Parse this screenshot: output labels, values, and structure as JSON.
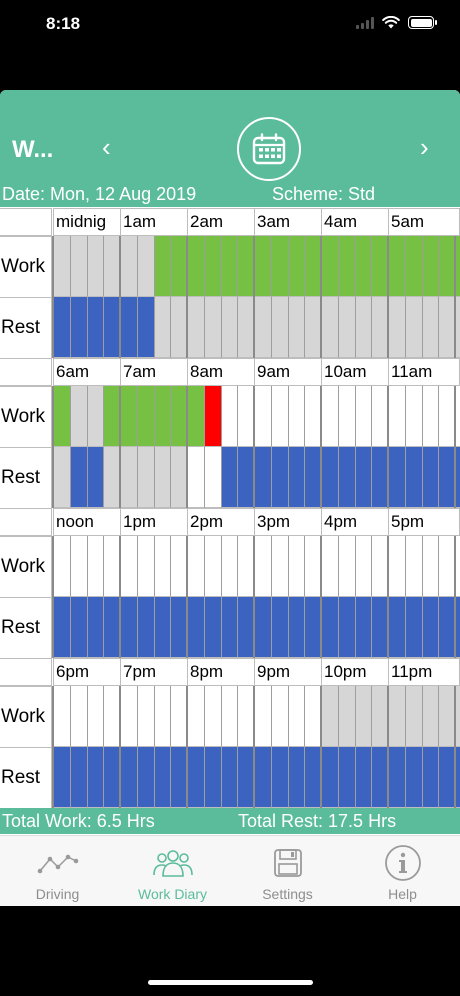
{
  "status": {
    "time": "8:18"
  },
  "header": {
    "title": "W...",
    "prev": "‹",
    "next": "›"
  },
  "info": {
    "date": "Date: Mon, 12 Aug 2019",
    "scheme": "Scheme: Std"
  },
  "row_labels": {
    "work": "Work",
    "rest": "Rest"
  },
  "colors": {
    "work": "#76c043",
    "rest": "#3b63bf",
    "none": "#d6d6d6",
    "empty": "#ffffff",
    "current": "#ff0000",
    "accent": "#5bbc9c"
  },
  "blocks": [
    {
      "hours": [
        "midnig",
        "1am",
        "2am",
        "3am",
        "4am",
        "5am"
      ],
      "work": "NNNNNNGGGGGGGGGGGGGGGGGG",
      "rest": "BBBBBBNNNNNNNNNNNNNNNNNN"
    },
    {
      "hours": [
        "6am",
        "7am",
        "8am",
        "9am",
        "10am",
        "11am"
      ],
      "work": "GNNGGGGGGRWWWWWWWWWWWWWW",
      "rest": "NBBNNNNNWWBBBBBBBBBBBBBB"
    },
    {
      "hours": [
        "noon",
        "1pm",
        "2pm",
        "3pm",
        "4pm",
        "5pm"
      ],
      "work": "WWWWWWWWWWWWWWWWWWWWWWWW",
      "rest": "BBBBBBBBBBBBBBBBBBBBBBBB"
    },
    {
      "hours": [
        "6pm",
        "7pm",
        "8pm",
        "9pm",
        "10pm",
        "11pm"
      ],
      "work": "WWWWWWWWWWWWWWWWNNNNNNNN",
      "rest": "BBBBBBBBBBBBBBBBBBBBBBBB"
    }
  ],
  "totals": {
    "work": "Total Work: 6.5 Hrs",
    "rest": "Total Rest: 17.5 Hrs"
  },
  "tabs": [
    {
      "label": "Driving",
      "icon": "chart-line-icon",
      "active": false
    },
    {
      "label": "Work Diary",
      "icon": "people-icon",
      "active": true
    },
    {
      "label": "Settings",
      "icon": "save-icon",
      "active": false
    },
    {
      "label": "Help",
      "icon": "info-icon",
      "active": false
    }
  ]
}
